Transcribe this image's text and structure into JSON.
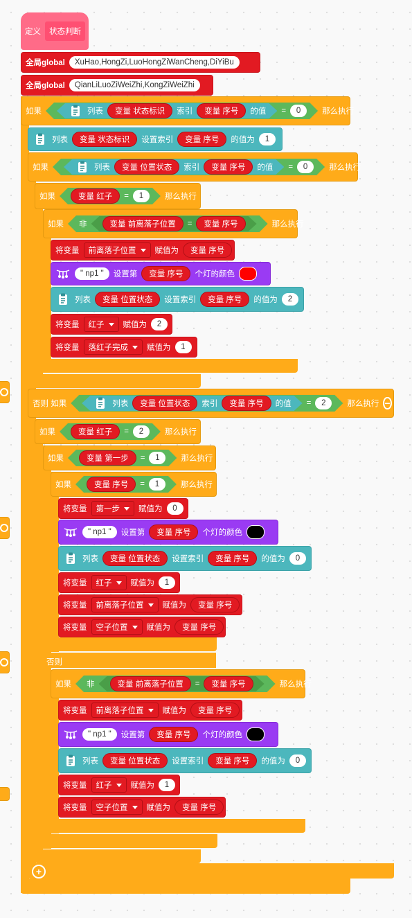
{
  "colors": {
    "orange": "#ffab19",
    "red": "#e21a22",
    "purple": "#9a3bf3",
    "teal": "#4cb7bd",
    "green": "#5cb85c",
    "pink": "#ff6b88",
    "led_red": "#ff0000",
    "led_black": "#000000"
  },
  "kw": {
    "define": "定义",
    "global": "全局global",
    "if": "如果",
    "then": "那么执行",
    "else": "否则",
    "else_if": "否则 如果",
    "list": "列表",
    "index": "索引",
    "value_of": "的值",
    "set_index": "设置索引",
    "value_to": "的值为",
    "not": "非",
    "set_var": "将变量",
    "assign": "赋值为",
    "equals": "=",
    "set_nth": "设置第",
    "led_color": "个灯的颜色"
  },
  "icons": {
    "list": "list-clipboard-icon",
    "led": "led-strip-icon",
    "add": "plus-circle-icon",
    "remove": "minus-circle-icon"
  },
  "header": {
    "func_name": "状态判断",
    "global1": "XuHao,HongZi,LuoHongZiWanCheng,DiYiBu",
    "global2": "QianLiLuoZiWeiZhi,KongZiWeiZhi"
  },
  "vars": {
    "status_flag": "变量 状态标识",
    "seq": "变量 序号",
    "pos_state": "变量 位置状态",
    "red": "变量 红子",
    "prev_pos": "变量 前离落子位置",
    "step1": "变量 第一步"
  },
  "dd": {
    "prev_pos": "前离落子位置",
    "red": "红子",
    "red_done": "落红子完成",
    "step1": "第一步",
    "empty_pos": "空子位置"
  },
  "strip": "\" np1 \"",
  "nums": {
    "zero": "0",
    "one": "1",
    "two": "2"
  }
}
